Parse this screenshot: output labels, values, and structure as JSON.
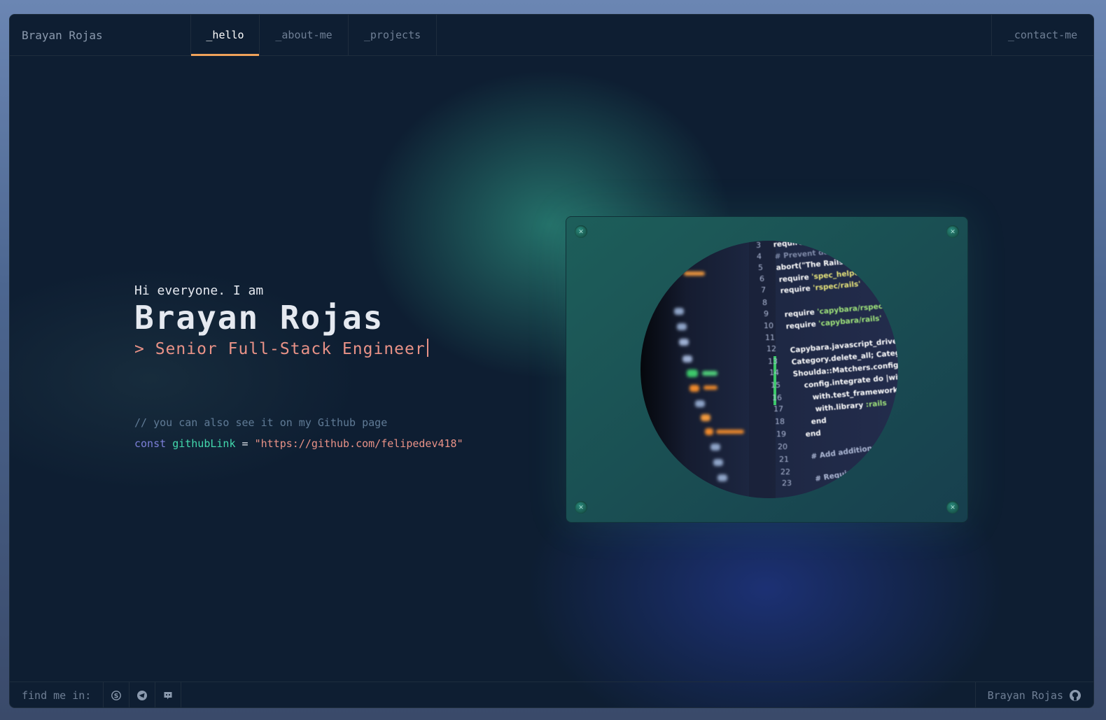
{
  "header": {
    "brand": "Brayan Rojas",
    "tabs": [
      {
        "label": "_hello",
        "active": true
      },
      {
        "label": "_about-me",
        "active": false
      },
      {
        "label": "_projects",
        "active": false
      }
    ],
    "contact_label": "_contact-me"
  },
  "hero": {
    "greeting": "Hi everyone. I am",
    "name": "Brayan Rojas",
    "role": "> Senior Full-Stack Engineer"
  },
  "code": {
    "comment": "// you can also see it on my Github page",
    "keyword": "const",
    "variable": "githubLink",
    "operator": "=",
    "value": "\"https://github.com/felipedev418\""
  },
  "footer": {
    "find_label": "find me in:",
    "social_icons": [
      "skype-icon",
      "telegram-icon",
      "discord-icon"
    ],
    "github_label": "Brayan Rojas",
    "github_icon": "github-icon"
  },
  "colors": {
    "accent_orange": "#f0a25a",
    "role_salmon": "#e99287",
    "keyword_purple": "#7c7fd8",
    "variable_green": "#43d9ad",
    "background": "#0e1e32"
  }
}
